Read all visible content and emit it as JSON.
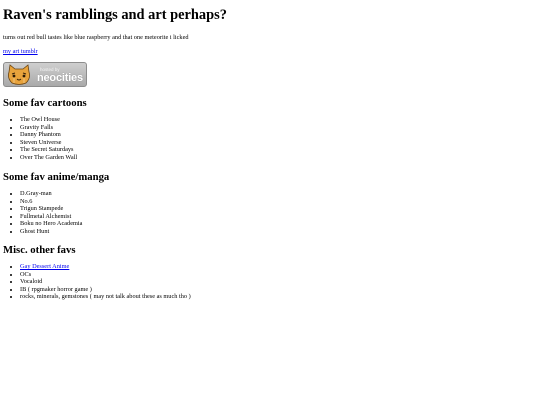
{
  "header": {
    "title": "Raven's ramblings and art perhaps?",
    "tagline": "turns out red bull tastes like blue raspberry and that one meteorite i licked",
    "link_label": "my art tumblr"
  },
  "badge": {
    "hosted_by": "hosted by",
    "brand": "neocities",
    "icon": "neocities-cat-icon"
  },
  "cartoons": {
    "heading": "Some fav cartoons",
    "items": [
      "The Owl House",
      "Gravity Falls",
      "Danny Phantom",
      "Steven Universe",
      "The Secret Saturdays",
      "Over The Garden Wall"
    ]
  },
  "anime": {
    "heading": "Some fav anime/manga",
    "items": [
      "D.Gray-man",
      "No.6",
      "Trigun Stampede",
      "Fullmetal Alchemist",
      "Boku no Hero Academia",
      "Ghost Hunt"
    ]
  },
  "misc": {
    "heading": "Misc. other favs",
    "link_item": "Gay Dessert Anime",
    "items": [
      "OCs",
      "Vocaloid",
      "IB ( rpgmaker horror game )",
      "rocks, minerals, gemstones ( may not talk about these as much tho )"
    ]
  },
  "colors": {
    "link": "#0000ee",
    "text": "#000000",
    "badge_bg": "#b8b8b8",
    "cat_orange": "#e8a33c"
  }
}
